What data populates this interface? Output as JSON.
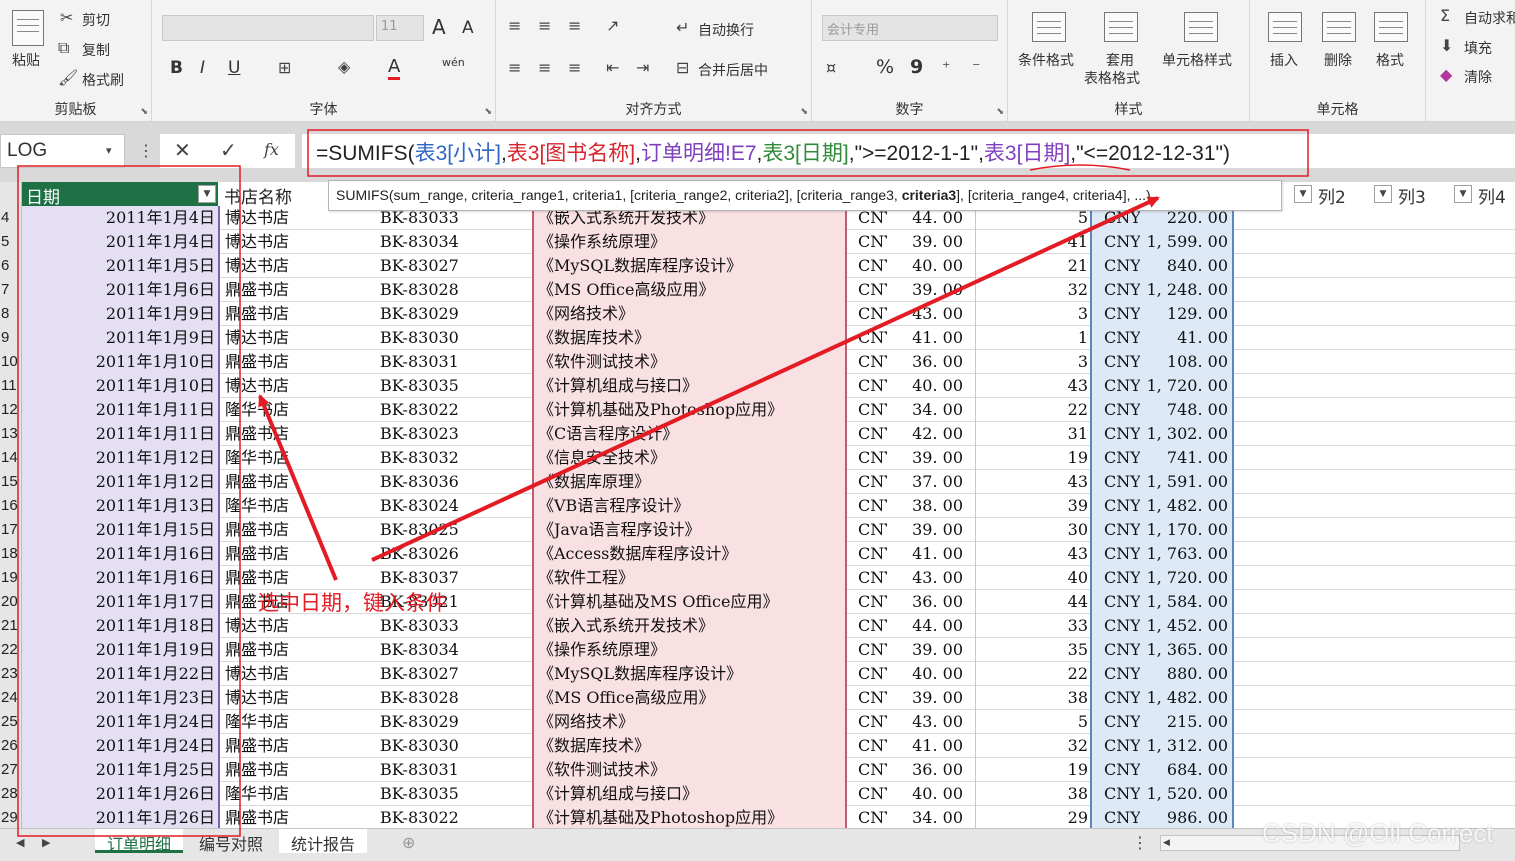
{
  "ribbon": {
    "clipboard": {
      "paste": "粘贴",
      "cut": "剪切",
      "copy": "复制",
      "format_painter": "格式刷",
      "group": "剪贴板"
    },
    "font": {
      "font_name": "",
      "font_size": "11",
      "grow": "A",
      "shrink": "A",
      "bold": "B",
      "italic": "I",
      "underline": "U",
      "font_color": "A",
      "phonetic": "wén",
      "group": "字体"
    },
    "align": {
      "wrap": "自动换行",
      "merge": "合并后居中",
      "group": "对齐方式"
    },
    "number": {
      "format": "会计专用",
      "percent": "%",
      "comma": "9",
      "group": "数字"
    },
    "styles": {
      "conditional": "条件格式",
      "as_table_1": "套用",
      "as_table_2": "表格格式",
      "cell_styles": "单元格样式",
      "group": "样式"
    },
    "cells": {
      "insert": "插入",
      "delete": "删除",
      "format": "格式",
      "group": "单元格"
    },
    "editing": {
      "autosum": "自动求和",
      "fill": "填充",
      "clear": "清除"
    }
  },
  "formula_bar": {
    "name_box": "LOG",
    "cancel": "✕",
    "enter": "✓",
    "fx": "fx",
    "formula_parts": [
      {
        "text": "=SUMIFS(",
        "color": "#222222"
      },
      {
        "text": "表3[小计]",
        "color": "#2f64c8"
      },
      {
        "text": ",",
        "color": "#222222"
      },
      {
        "text": "表3[图书名称]",
        "color": "#d8252e"
      },
      {
        "text": ",",
        "color": "#222222"
      },
      {
        "text": "订单明细!E7",
        "color": "#7f3fbf"
      },
      {
        "text": ",",
        "color": "#222222"
      },
      {
        "text": "表3[日期]",
        "color": "#2e8b3a"
      },
      {
        "text": ",\">=2012-1-1\",",
        "color": "#222222"
      },
      {
        "text": "表3[日期]",
        "color": "#7f3fbf"
      },
      {
        "text": ",\"<=2012-12-31\"",
        "color": "#222222"
      },
      {
        "text": ")",
        "color": "#222222"
      }
    ]
  },
  "tooltip": {
    "before": "SUMIFS(sum_range, criteria_range1, criteria1, [criteria_range2, criteria2], [criteria_range3, ",
    "bold": "criteria3",
    "after": "], [criteria_range4, criteria4], ...)"
  },
  "headers": {
    "date": "日期",
    "store": "书店名称",
    "col2": "列2",
    "col3": "列3",
    "col4": "列4"
  },
  "rows": [
    {
      "n": "4",
      "date": "2011年1月4日",
      "store": "博达书店",
      "code": "BK-83033",
      "title": "《嵌入式系统开发技术》",
      "cur": "CNY",
      "price": "44. 00",
      "qty": "5",
      "sub": "220. 00"
    },
    {
      "n": "5",
      "date": "2011年1月4日",
      "store": "博达书店",
      "code": "BK-83034",
      "title": "《操作系统原理》",
      "cur": "CNY",
      "price": "39. 00",
      "qty": "41",
      "sub": "1, 599. 00"
    },
    {
      "n": "6",
      "date": "2011年1月5日",
      "store": "博达书店",
      "code": "BK-83027",
      "title": "《MySQL数据库程序设计》",
      "cur": "CNY",
      "price": "40. 00",
      "qty": "21",
      "sub": "840. 00"
    },
    {
      "n": "7",
      "date": "2011年1月6日",
      "store": "鼎盛书店",
      "code": "BK-83028",
      "title": "《MS Office高级应用》",
      "cur": "CNY",
      "price": "39. 00",
      "qty": "32",
      "sub": "1, 248. 00"
    },
    {
      "n": "8",
      "date": "2011年1月9日",
      "store": "鼎盛书店",
      "code": "BK-83029",
      "title": "《网络技术》",
      "cur": "CNY",
      "price": "43. 00",
      "qty": "3",
      "sub": "129. 00"
    },
    {
      "n": "9",
      "date": "2011年1月9日",
      "store": "博达书店",
      "code": "BK-83030",
      "title": "《数据库技术》",
      "cur": "CNY",
      "price": "41. 00",
      "qty": "1",
      "sub": "41. 00"
    },
    {
      "n": "10",
      "date": "2011年1月10日",
      "store": "鼎盛书店",
      "code": "BK-83031",
      "title": "《软件测试技术》",
      "cur": "CNY",
      "price": "36. 00",
      "qty": "3",
      "sub": "108. 00"
    },
    {
      "n": "11",
      "date": "2011年1月10日",
      "store": "博达书店",
      "code": "BK-83035",
      "title": "《计算机组成与接口》",
      "cur": "CNY",
      "price": "40. 00",
      "qty": "43",
      "sub": "1, 720. 00"
    },
    {
      "n": "12",
      "date": "2011年1月11日",
      "store": "隆华书店",
      "code": "BK-83022",
      "title": "《计算机基础及Photoshop应用》",
      "cur": "CNY",
      "price": "34. 00",
      "qty": "22",
      "sub": "748. 00"
    },
    {
      "n": "13",
      "date": "2011年1月11日",
      "store": "鼎盛书店",
      "code": "BK-83023",
      "title": "《C语言程序设计》",
      "cur": "CNY",
      "price": "42. 00",
      "qty": "31",
      "sub": "1, 302. 00"
    },
    {
      "n": "14",
      "date": "2011年1月12日",
      "store": "隆华书店",
      "code": "BK-83032",
      "title": "《信息安全技术》",
      "cur": "CNY",
      "price": "39. 00",
      "qty": "19",
      "sub": "741. 00"
    },
    {
      "n": "15",
      "date": "2011年1月12日",
      "store": "鼎盛书店",
      "code": "BK-83036",
      "title": "《数据库原理》",
      "cur": "CNY",
      "price": "37. 00",
      "qty": "43",
      "sub": "1, 591. 00"
    },
    {
      "n": "16",
      "date": "2011年1月13日",
      "store": "隆华书店",
      "code": "BK-83024",
      "title": "《VB语言程序设计》",
      "cur": "CNY",
      "price": "38. 00",
      "qty": "39",
      "sub": "1, 482. 00"
    },
    {
      "n": "17",
      "date": "2011年1月15日",
      "store": "鼎盛书店",
      "code": "BK-83025",
      "title": "《Java语言程序设计》",
      "cur": "CNY",
      "price": "39. 00",
      "qty": "30",
      "sub": "1, 170. 00"
    },
    {
      "n": "18",
      "date": "2011年1月16日",
      "store": "鼎盛书店",
      "code": "BK-83026",
      "title": "《Access数据库程序设计》",
      "cur": "CNY",
      "price": "41. 00",
      "qty": "43",
      "sub": "1, 763. 00"
    },
    {
      "n": "19",
      "date": "2011年1月16日",
      "store": "鼎盛书店",
      "code": "BK-83037",
      "title": "《软件工程》",
      "cur": "CNY",
      "price": "43. 00",
      "qty": "40",
      "sub": "1, 720. 00"
    },
    {
      "n": "20",
      "date": "2011年1月17日",
      "store": "鼎盛书店",
      "code": "BK-83021",
      "title": "《计算机基础及MS Office应用》",
      "cur": "CNY",
      "price": "36. 00",
      "qty": "44",
      "sub": "1, 584. 00"
    },
    {
      "n": "21",
      "date": "2011年1月18日",
      "store": "博达书店",
      "code": "BK-83033",
      "title": "《嵌入式系统开发技术》",
      "cur": "CNY",
      "price": "44. 00",
      "qty": "33",
      "sub": "1, 452. 00"
    },
    {
      "n": "22",
      "date": "2011年1月19日",
      "store": "鼎盛书店",
      "code": "BK-83034",
      "title": "《操作系统原理》",
      "cur": "CNY",
      "price": "39. 00",
      "qty": "35",
      "sub": "1, 365. 00"
    },
    {
      "n": "23",
      "date": "2011年1月22日",
      "store": "博达书店",
      "code": "BK-83027",
      "title": "《MySQL数据库程序设计》",
      "cur": "CNY",
      "price": "40. 00",
      "qty": "22",
      "sub": "880. 00"
    },
    {
      "n": "24",
      "date": "2011年1月23日",
      "store": "博达书店",
      "code": "BK-83028",
      "title": "《MS Office高级应用》",
      "cur": "CNY",
      "price": "39. 00",
      "qty": "38",
      "sub": "1, 482. 00"
    },
    {
      "n": "25",
      "date": "2011年1月24日",
      "store": "隆华书店",
      "code": "BK-83029",
      "title": "《网络技术》",
      "cur": "CNY",
      "price": "43. 00",
      "qty": "5",
      "sub": "215. 00"
    },
    {
      "n": "26",
      "date": "2011年1月24日",
      "store": "鼎盛书店",
      "code": "BK-83030",
      "title": "《数据库技术》",
      "cur": "CNY",
      "price": "41. 00",
      "qty": "32",
      "sub": "1, 312. 00"
    },
    {
      "n": "27",
      "date": "2011年1月25日",
      "store": "鼎盛书店",
      "code": "BK-83031",
      "title": "《软件测试技术》",
      "cur": "CNY",
      "price": "36. 00",
      "qty": "19",
      "sub": "684. 00"
    },
    {
      "n": "28",
      "date": "2011年1月26日",
      "store": "隆华书店",
      "code": "BK-83035",
      "title": "《计算机组成与接口》",
      "cur": "CNY",
      "price": "40. 00",
      "qty": "38",
      "sub": "1, 520. 00"
    },
    {
      "n": "29",
      "date": "2011年1月26日",
      "store": "鼎盛书店",
      "code": "BK-83022",
      "title": "《计算机基础及Photoshop应用》",
      "cur": "CNY",
      "price": "34. 00",
      "qty": "29",
      "sub": "986. 00"
    }
  ],
  "sheet_tabs": [
    "订单明细",
    "编号对照",
    "统计报告"
  ],
  "annotation": {
    "text": "选中日期，键入条件",
    "color": "#e21b24"
  },
  "watermark": "CSDN @Oll Correct",
  "colors": {
    "date_band": "#e4dff2",
    "title_band": "#f9e1e3",
    "subtotal_band": "#dde9f6",
    "header_green": "#1e7145"
  }
}
